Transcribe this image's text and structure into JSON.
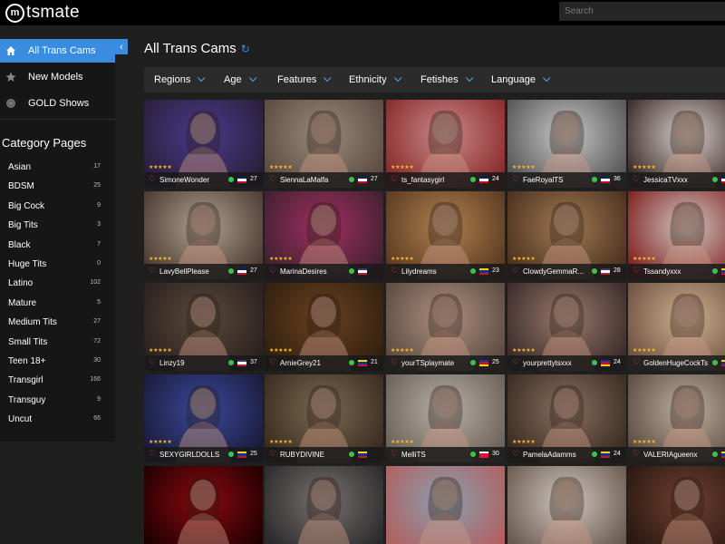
{
  "logo": {
    "text": "tsmate"
  },
  "search": {
    "placeholder": "Search"
  },
  "nav": [
    {
      "label": "All Trans Cams",
      "icon": "home-icon",
      "active": true
    },
    {
      "label": "New Models",
      "icon": "star-icon",
      "active": false
    },
    {
      "label": "GOLD Shows",
      "icon": "coin-icon",
      "active": false
    }
  ],
  "category_heading": "Category Pages",
  "categories": [
    {
      "label": "Asian",
      "count": "17"
    },
    {
      "label": "BDSM",
      "count": "25"
    },
    {
      "label": "Big Cock",
      "count": "9"
    },
    {
      "label": "Big Tits",
      "count": "3"
    },
    {
      "label": "Black",
      "count": "7"
    },
    {
      "label": "Huge Tits",
      "count": "0"
    },
    {
      "label": "Latino",
      "count": "102"
    },
    {
      "label": "Mature",
      "count": "5"
    },
    {
      "label": "Medium Tits",
      "count": "27"
    },
    {
      "label": "Small Tits",
      "count": "72"
    },
    {
      "label": "Teen 18+",
      "count": "30"
    },
    {
      "label": "Transgirl",
      "count": "166"
    },
    {
      "label": "Transguy",
      "count": "9"
    },
    {
      "label": "Uncut",
      "count": "66"
    }
  ],
  "main": {
    "title": "All Trans Cams"
  },
  "filters": [
    "Regions",
    "Age",
    "Features",
    "Ethnicity",
    "Fetishes",
    "Language"
  ],
  "stars": "★★★★★",
  "flags": {
    "uk": [
      "#012169",
      "#ffffff",
      "#c8102e"
    ],
    "us": [
      "#3c3b6e",
      "#ffffff",
      "#b22234"
    ],
    "co": [
      "#fcd116",
      "#003893",
      "#ce1126"
    ],
    "ph": [
      "#0038a8",
      "#ce1126",
      "#fcd116"
    ],
    "pl": [
      "#ffffff",
      "#dc143c",
      "#dc143c"
    ]
  },
  "models": [
    {
      "name": "SimoneWonder",
      "age": "27",
      "flag": "uk",
      "bg": [
        "#4a3a8c",
        "#2a1f3a"
      ]
    },
    {
      "name": "SiennaLaMalfa",
      "age": "27",
      "flag": "uk",
      "bg": [
        "#9a8a7c",
        "#5c4a40"
      ]
    },
    {
      "name": "ts_fantasygirl",
      "age": "24",
      "flag": "uk",
      "bg": [
        "#c98a8a",
        "#8a2a2a"
      ]
    },
    {
      "name": "FaeRoyalTS",
      "age": "36",
      "flag": "uk",
      "bg": [
        "#c8c8c8",
        "#555555"
      ]
    },
    {
      "name": "JessicaTVxxx",
      "age": "",
      "flag": "uk",
      "bg": [
        "#d8d0c8",
        "#3a2a2a"
      ]
    },
    {
      "name": "LavyBellPlease",
      "age": "27",
      "flag": "uk",
      "bg": [
        "#b0a090",
        "#4a3a30"
      ]
    },
    {
      "name": "MarinaDesires",
      "age": "",
      "flag": "us",
      "bg": [
        "#a03060",
        "#402030"
      ]
    },
    {
      "name": "Lilydreams",
      "age": "23",
      "flag": "co",
      "bg": [
        "#b08050",
        "#5a3a20"
      ]
    },
    {
      "name": "ClowdyGemmaR...",
      "age": "28",
      "flag": "us",
      "bg": [
        "#a07a50",
        "#4a3020"
      ]
    },
    {
      "name": "Tssandyxxx",
      "age": "",
      "flag": "co",
      "bg": [
        "#d0c8c0",
        "#802020"
      ]
    },
    {
      "name": "Linzy19",
      "age": "37",
      "flag": "us",
      "bg": [
        "#5a4a3a",
        "#2a2020"
      ]
    },
    {
      "name": "ArnieGrey21",
      "age": "21",
      "flag": "co",
      "bg": [
        "#6a4020",
        "#302010"
      ]
    },
    {
      "name": "yourTSplaymate",
      "age": "25",
      "flag": "ph",
      "bg": [
        "#b09080",
        "#5a4a40"
      ]
    },
    {
      "name": "yourprettytsxxx",
      "age": "24",
      "flag": "ph",
      "bg": [
        "#9a7a6a",
        "#3a2a2a"
      ]
    },
    {
      "name": "GoldenHugeCockTs",
      "age": "",
      "flag": "co",
      "bg": [
        "#d0b090",
        "#6a5040"
      ]
    },
    {
      "name": "SEXYGIRLDOLLS",
      "age": "25",
      "flag": "co",
      "bg": [
        "#3a4a9a",
        "#1a1a3a"
      ]
    },
    {
      "name": "RUBYDIVINE",
      "age": "",
      "flag": "co",
      "bg": [
        "#7a6a50",
        "#3a2a20"
      ]
    },
    {
      "name": "MelliTS",
      "age": "30",
      "flag": "pl",
      "bg": [
        "#b8b0a8",
        "#6a6058"
      ]
    },
    {
      "name": "PamelaAdamms",
      "age": "24",
      "flag": "co",
      "bg": [
        "#8a7060",
        "#3a2a20"
      ]
    },
    {
      "name": "VALERIAgueenx",
      "age": "",
      "flag": "co",
      "bg": [
        "#c0b0a0",
        "#5a4a40"
      ]
    },
    {
      "name": "",
      "age": "",
      "flag": "",
      "bg": [
        "#8a0a10",
        "#200000"
      ]
    },
    {
      "name": "",
      "age": "",
      "flag": "",
      "bg": [
        "#7a7070",
        "#2a2a2a"
      ]
    },
    {
      "name": "",
      "age": "",
      "flag": "",
      "bg": [
        "#8aa0b0",
        "#b06060"
      ]
    },
    {
      "name": "",
      "age": "",
      "flag": "",
      "bg": [
        "#d0c8c0",
        "#6a5a50"
      ]
    },
    {
      "name": "",
      "age": "",
      "flag": "",
      "bg": [
        "#704030",
        "#2a1810"
      ]
    }
  ]
}
